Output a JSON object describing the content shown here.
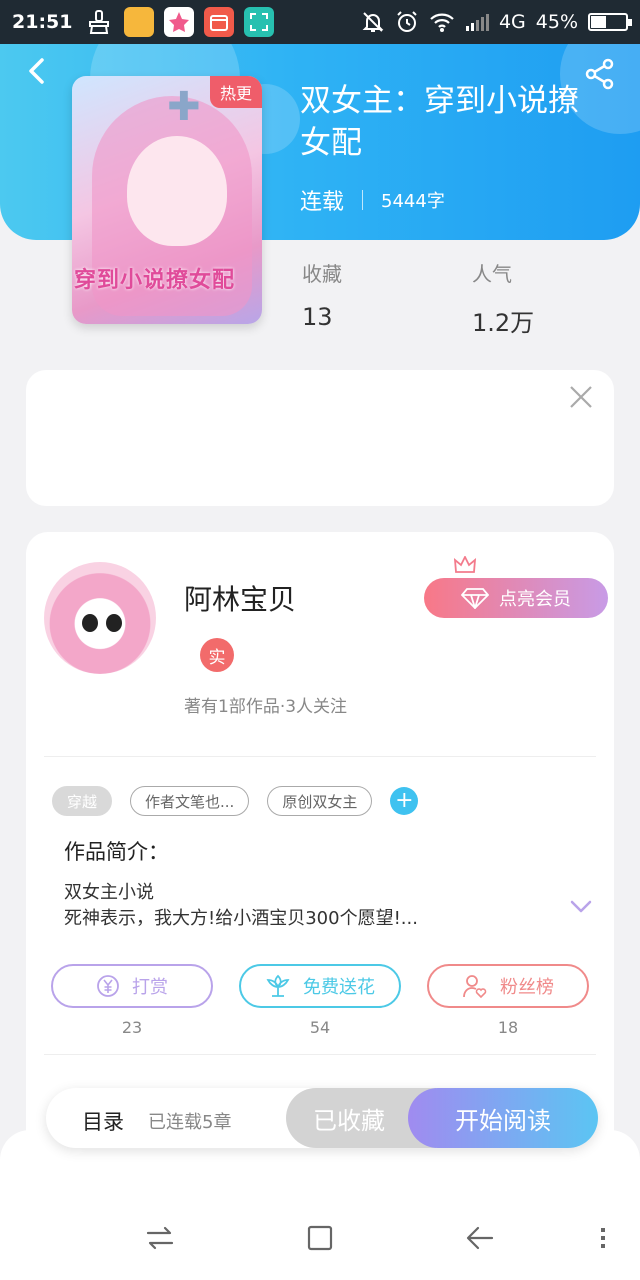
{
  "status_bar": {
    "time": "21:51",
    "network": "4G",
    "battery_percent": "45%",
    "battery_level": 0.45
  },
  "book": {
    "title": "双女主：穿到小说撩女配",
    "status": "连载",
    "word_count": "5444字",
    "hot_tag": "热更",
    "cover_title": "穿到小说撩女配"
  },
  "stats": {
    "favorites_label": "收藏",
    "favorites_value": "13",
    "popularity_label": "人气",
    "popularity_value": "1.2万"
  },
  "author": {
    "name": "阿林宝贝",
    "real_badge": "实",
    "summary": "著有1部作品·3人关注",
    "vip_button": "点亮会员"
  },
  "tags": [
    "穿越",
    "作者文笔也...",
    "原创双女主"
  ],
  "tag_add": "+",
  "intro": {
    "title": "作品简介：",
    "line1": "双女主小说",
    "line2": "死神表示，我大方!给小酒宝贝300个愿望!..."
  },
  "actions": [
    {
      "label": "打赏",
      "count": "23",
      "color": "#b9a3ea"
    },
    {
      "label": "免费送花",
      "count": "54",
      "color": "#4cc9e6"
    },
    {
      "label": "粉丝榜",
      "count": "18",
      "color": "#f08a8a"
    }
  ],
  "bottom_bar": {
    "toc": "目录",
    "chapters": "已连载5章",
    "favorited": "已收藏",
    "start_reading": "开始阅读"
  },
  "icons": {
    "back": "chevron-left-icon",
    "share": "share-icon",
    "close": "close-icon",
    "crown": "crown-icon",
    "diamond": "diamond-icon",
    "yen": "yen-icon",
    "flower": "flower-icon",
    "fan": "person-heart-icon",
    "expand": "chevron-down-icon"
  },
  "colors": {
    "header_start": "#4cc9f0",
    "header_end": "#1e9df2",
    "hot_tag": "#ef5d6a",
    "vip_start": "#f87887",
    "vip_end": "#c89be6",
    "read_start": "#a08bf0",
    "read_end": "#5bc5f3"
  }
}
